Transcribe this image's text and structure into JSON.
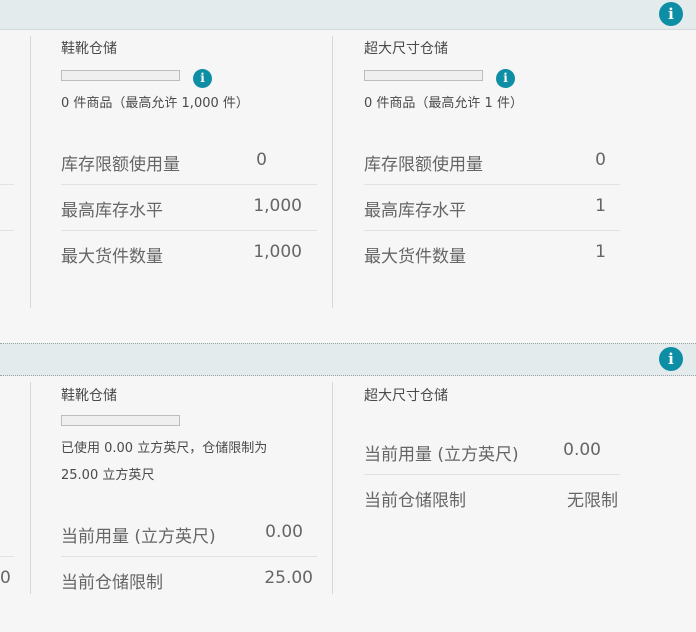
{
  "info_glyph": "i",
  "icons": {
    "section_info": "info-circle-icon",
    "meter_info": "info-circle-icon"
  },
  "colors": {
    "accent": "#0e8ea5",
    "bar_bg": "#e4ebec"
  },
  "inventory_limits": {
    "shoe_storage": {
      "title": "鞋靴仓储",
      "caption": "0 件商品（最高允许 1,000 件）",
      "fill_fraction": 0,
      "rows": [
        {
          "label": "库存限额使用量",
          "value": "0"
        },
        {
          "label": "最高库存水平",
          "value": "1,000"
        },
        {
          "label": "最大货件数量",
          "value": "1,000"
        }
      ]
    },
    "oversize_storage": {
      "title": "超大尺寸仓储",
      "caption": "0 件商品（最高允许 1 件）",
      "fill_fraction": 0,
      "rows": [
        {
          "label": "库存限额使用量",
          "value": "0"
        },
        {
          "label": "最高库存水平",
          "value": "1"
        },
        {
          "label": "最大货件数量",
          "value": "1"
        }
      ]
    }
  },
  "storage_volume": {
    "left_partial_value": "0",
    "shoe_storage": {
      "title": "鞋靴仓储",
      "caption_line1": "已使用 0.00 立方英尺，仓储限制为",
      "caption_line2": "25.00 立方英尺",
      "fill_fraction": 0,
      "rows": [
        {
          "label": "当前用量 (立方英尺)",
          "value": "0.00"
        },
        {
          "label": "当前仓储限制",
          "value": "25.00"
        }
      ]
    },
    "oversize_storage": {
      "title": "超大尺寸仓储",
      "rows": [
        {
          "label": "当前用量 (立方英尺)",
          "value": "0.00"
        },
        {
          "label": "当前仓储限制",
          "value": "无限制"
        }
      ]
    }
  }
}
